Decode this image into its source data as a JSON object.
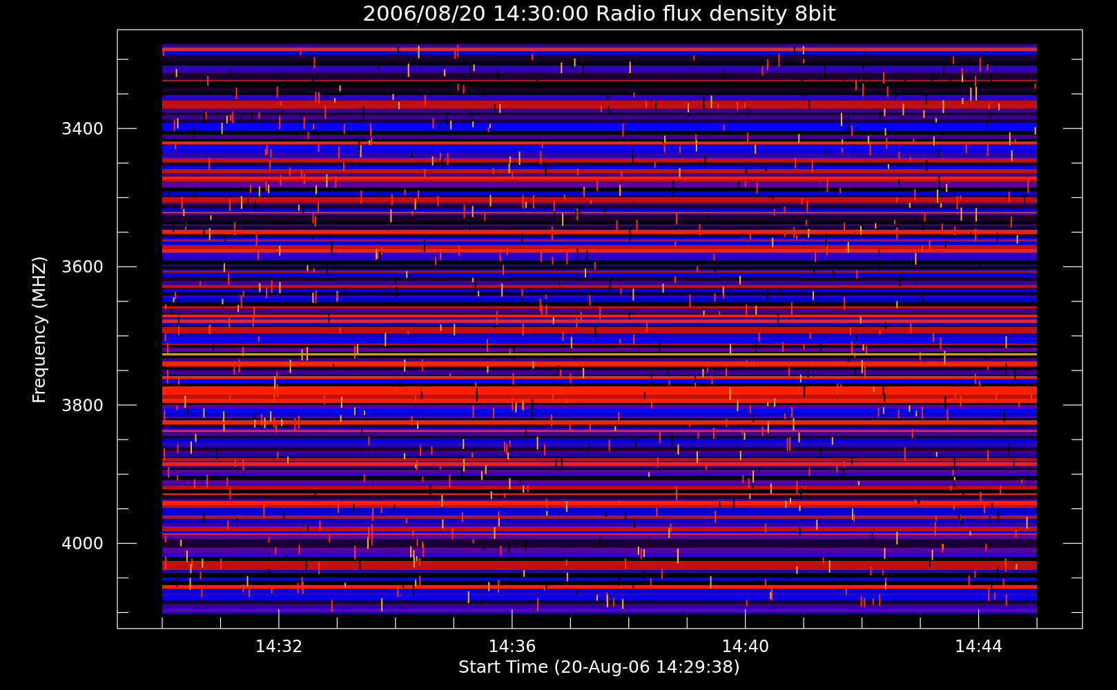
{
  "chart": {
    "title": "2006/08/20 14:30:00 Radio flux density 8bit",
    "ylabel": "Frequency (MHZ)",
    "xlabel": "Start Time (20-Aug-06 14:29:38)",
    "yticks": [
      "3400",
      "3600",
      "3800",
      "4000"
    ],
    "xticks": [
      "14:32",
      "14:36",
      "14:40",
      "14:44"
    ]
  }
}
